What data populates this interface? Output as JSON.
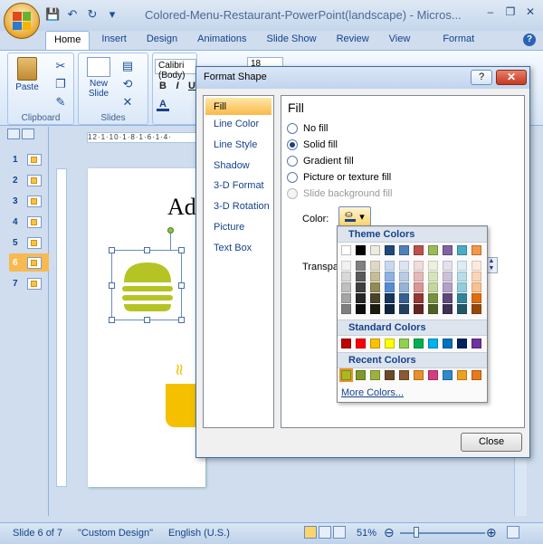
{
  "window": {
    "title": "Colored-Menu-Restaurant-PowerPoint(landscape) - Micros...",
    "buttons": [
      "‒",
      "❐",
      "✕"
    ]
  },
  "ribbon": {
    "tabs": [
      "Home",
      "Insert",
      "Design",
      "Animations",
      "Slide Show",
      "Review",
      "View",
      "Format"
    ],
    "active_tab": "Home",
    "clipboard": {
      "paste": "Paste",
      "group_label": "Clipboard"
    },
    "slides": {
      "new_slide_line1": "New",
      "new_slide_line2": "Slide",
      "group_label": "Slides"
    },
    "font": {
      "name": "Calibri (Body)",
      "size": "18"
    }
  },
  "slide_panel": {
    "numbers": [
      "1",
      "2",
      "3",
      "4",
      "5",
      "6",
      "7"
    ],
    "selected": "6"
  },
  "slide": {
    "title_visible": "Ad",
    "ruler_text": "12·1·10·1·8·1·6·1·4·"
  },
  "status_bar": {
    "slide_info": "Slide 6 of 7",
    "theme": "\"Custom Design\"",
    "language": "English (U.S.)",
    "zoom": "51%"
  },
  "dialog": {
    "title": "Format Shape",
    "help": "?",
    "close_x": "✕",
    "nav_items": [
      "Fill",
      "Line Color",
      "Line Style",
      "Shadow",
      "3-D Format",
      "3-D Rotation",
      "Picture",
      "Text Box"
    ],
    "active_nav": "Fill",
    "panel_heading": "Fill",
    "fill_options": [
      {
        "label": "No fill",
        "checked": false,
        "enabled": true
      },
      {
        "label": "Solid fill",
        "checked": true,
        "enabled": true
      },
      {
        "label": "Gradient fill",
        "checked": false,
        "enabled": true
      },
      {
        "label": "Picture or texture fill",
        "checked": false,
        "enabled": true
      },
      {
        "label": "Slide background fill",
        "checked": false,
        "enabled": false
      }
    ],
    "color_label": "Color:",
    "transparency_label": "Transpa",
    "close_button": "Close"
  },
  "color_palette": {
    "theme_heading": "Theme Colors",
    "standard_heading": "Standard Colors",
    "recent_heading": "Recent Colors",
    "more_colors": "More Colors...",
    "theme_row": [
      "#ffffff",
      "#000000",
      "#eeece1",
      "#1f497d",
      "#4f81bd",
      "#c0504d",
      "#9bbb59",
      "#8064a2",
      "#4bacc6",
      "#f79646"
    ],
    "theme_shades": [
      [
        "#f2f2f2",
        "#d8d8d8",
        "#bfbfbf",
        "#a5a5a5",
        "#7f7f7f"
      ],
      [
        "#7f7f7f",
        "#595959",
        "#3f3f3f",
        "#262626",
        "#0c0c0c"
      ],
      [
        "#ddd9c3",
        "#c4bd97",
        "#938953",
        "#494429",
        "#1d1b10"
      ],
      [
        "#c6d9f0",
        "#8db3e2",
        "#548dd4",
        "#17365d",
        "#0f243e"
      ],
      [
        "#dbe5f1",
        "#b8cce4",
        "#95b3d7",
        "#366092",
        "#244061"
      ],
      [
        "#f2dcdb",
        "#e5b9b7",
        "#d99694",
        "#953734",
        "#632423"
      ],
      [
        "#ebf1dd",
        "#d7e3bc",
        "#c3d69b",
        "#76923c",
        "#4f6128"
      ],
      [
        "#e5e0ec",
        "#ccc1d9",
        "#b2a2c7",
        "#5f497a",
        "#3f3151"
      ],
      [
        "#dbeef3",
        "#b7dde8",
        "#92cddc",
        "#31859b",
        "#205867"
      ],
      [
        "#fdeada",
        "#fbd5b5",
        "#fac08f",
        "#e36c09",
        "#974806"
      ]
    ],
    "standard_row": [
      "#c00000",
      "#ff0000",
      "#ffc000",
      "#ffff00",
      "#92d050",
      "#00b050",
      "#00b0f0",
      "#0070c0",
      "#002060",
      "#7030a0"
    ],
    "recent_row": [
      "#a8b820",
      "#7f9a28",
      "#a0b040",
      "#6b4a2a",
      "#8a5a30",
      "#e8912c",
      "#d63a82",
      "#2e8acb",
      "#f0a020",
      "#e87a1a"
    ]
  }
}
